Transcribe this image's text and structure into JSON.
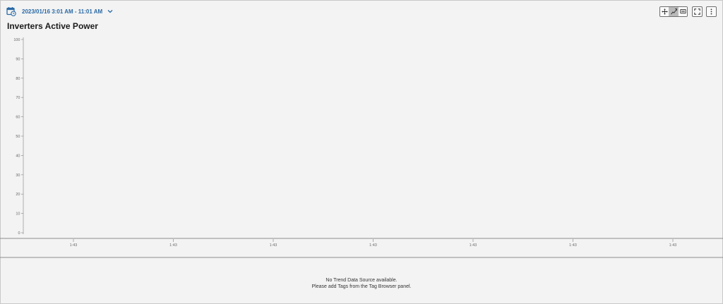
{
  "header": {
    "time_range": "2023/01/16 3:01 AM - 11:01 AM",
    "calendar_icon": "calendar-clock-icon",
    "dropdown_icon": "chevron-down-icon"
  },
  "toolbar": {
    "buttons": [
      {
        "icon": "pan-move-icon",
        "active": false
      },
      {
        "icon": "zoom-line-icon",
        "active": true
      },
      {
        "icon": "annotation-icon",
        "active": false
      }
    ],
    "fullscreen_icon": "fullscreen-icon",
    "more_icon": "more-vertical-icon"
  },
  "chart_data": {
    "type": "line",
    "title": "Inverters Active Power",
    "xlabel": "",
    "ylabel": "",
    "ylim": [
      0,
      100
    ],
    "y_ticks": [
      "0",
      "10",
      "20",
      "30",
      "40",
      "50",
      "60",
      "70",
      "80",
      "90",
      "100"
    ],
    "x_ticks": [
      "1:43",
      "1:43",
      "1:43",
      "1:43",
      "1:43",
      "1:43",
      "1:43"
    ],
    "series": []
  },
  "empty_state": {
    "line1": "No Trend Data Source available.",
    "line2": "Please add Tags from the Tag Browser panel."
  },
  "colors": {
    "accent": "#2a6aa6",
    "background": "#f3f3f3",
    "axis": "#9a9a9a"
  }
}
